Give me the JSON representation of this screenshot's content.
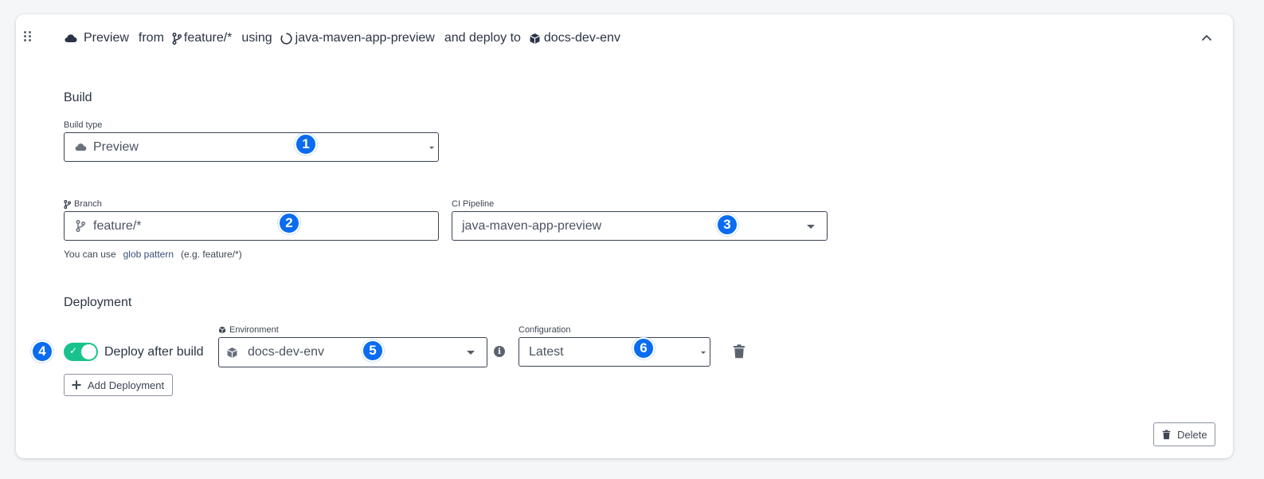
{
  "header": {
    "build_type": "Preview",
    "from_text": "from",
    "branch": "feature/*",
    "using_text": "using",
    "pipeline": "java-maven-app-preview",
    "deploy_to_text": "and deploy to",
    "environment": "docs-dev-env",
    "collapse_icon": "chevron-up-icon"
  },
  "build": {
    "title": "Build",
    "build_type_label": "Build type",
    "build_type_value": "Preview",
    "branch_label": "Branch",
    "branch_value": "feature/*",
    "pipeline_label": "CI Pipeline",
    "pipeline_value": "java-maven-app-preview",
    "hint_prefix": "You can use",
    "hint_link": "glob pattern",
    "hint_suffix": "(e.g. feature/*)"
  },
  "deployment": {
    "title": "Deployment",
    "toggle_label": "Deploy after build",
    "toggle_on": true,
    "environment_label": "Environment",
    "environment_value": "docs-dev-env",
    "configuration_label": "Configuration",
    "configuration_value": "Latest",
    "add_button_label": "Add Deployment"
  },
  "footer": {
    "delete_label": "Delete"
  },
  "badges": [
    "1",
    "2",
    "3",
    "4",
    "5",
    "6"
  ],
  "colors": {
    "badge": "#0a6cf0",
    "toggle_on": "#19c28a",
    "text": "#2b3445",
    "border": "#3a4354"
  }
}
